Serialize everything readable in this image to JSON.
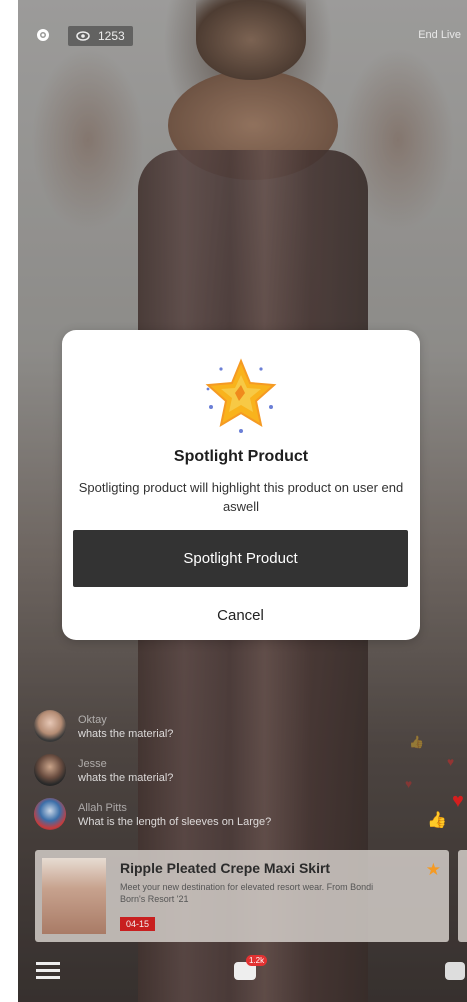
{
  "top_bar": {
    "viewer_count": "1253",
    "end_live_label": "End Live"
  },
  "comments": [
    {
      "name": "Oktay",
      "message": "whats the material?"
    },
    {
      "name": "Jesse",
      "message": "whats the material?"
    },
    {
      "name": "Allah Pitts",
      "message": "What is the length of sleeves on Large?"
    }
  ],
  "product": {
    "title": "Ripple Pleated Crepe Maxi Skirt",
    "description": "Meet your new destination for elevated resort wear. From Bondi Born's Resort '21",
    "badge": "04-15"
  },
  "bottom_bar": {
    "chat_count": "1.2k"
  },
  "modal": {
    "title": "Spotlight Product",
    "body": "Spotligting product will highlight this product on user end aswell",
    "primary_label": "Spotlight Product",
    "cancel_label": "Cancel"
  },
  "colors": {
    "accent_dark": "#333333",
    "badge_red": "#c81f1f",
    "star_gold": "#f9b31c",
    "favorite_orange": "#f59a23"
  }
}
